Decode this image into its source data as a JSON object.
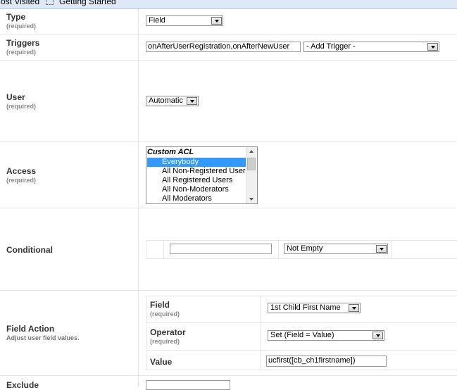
{
  "bookmarks": {
    "most_visited": "Most Visited",
    "getting_started": "Getting Started"
  },
  "rows": {
    "type": {
      "label": "Type",
      "required": "(required)",
      "value": "Field"
    },
    "triggers": {
      "label": "Triggers",
      "required": "(required)",
      "value": "onAfterUserRegistration,onAfterNewUser",
      "add_trigger": "- Add Trigger -"
    },
    "user": {
      "label": "User",
      "required": "(required)",
      "value": "Automatic"
    },
    "access": {
      "label": "Access",
      "required": "(required)",
      "group": "Custom ACL",
      "options": [
        "Everybody",
        "All Non-Registered Users",
        "All Registered Users",
        "All Non-Moderators",
        "All Moderators"
      ],
      "selected": "Everybody"
    },
    "conditional": {
      "label": "Conditional",
      "field_value": "",
      "operator": "Not Empty"
    },
    "field_action": {
      "label": "Field Action",
      "description": "Adjust user field values.",
      "field": {
        "label": "Field",
        "required": "(required)",
        "value": "1st Child First Name"
      },
      "operator": {
        "label": "Operator",
        "required": "(required)",
        "value": "Set (Field = Value)"
      },
      "value": {
        "label": "Value",
        "value": "ucfirst([cb_ch1firstname])"
      }
    },
    "exclude": {
      "label": "Exclude",
      "value": ""
    }
  },
  "icons": {
    "bookmark": "page-icon",
    "dropdown": "chevron-down-icon"
  },
  "colors": {
    "selection": "#3399ff",
    "border": "#e4e4e4",
    "bookmark_bar": "#dfe8f6"
  }
}
